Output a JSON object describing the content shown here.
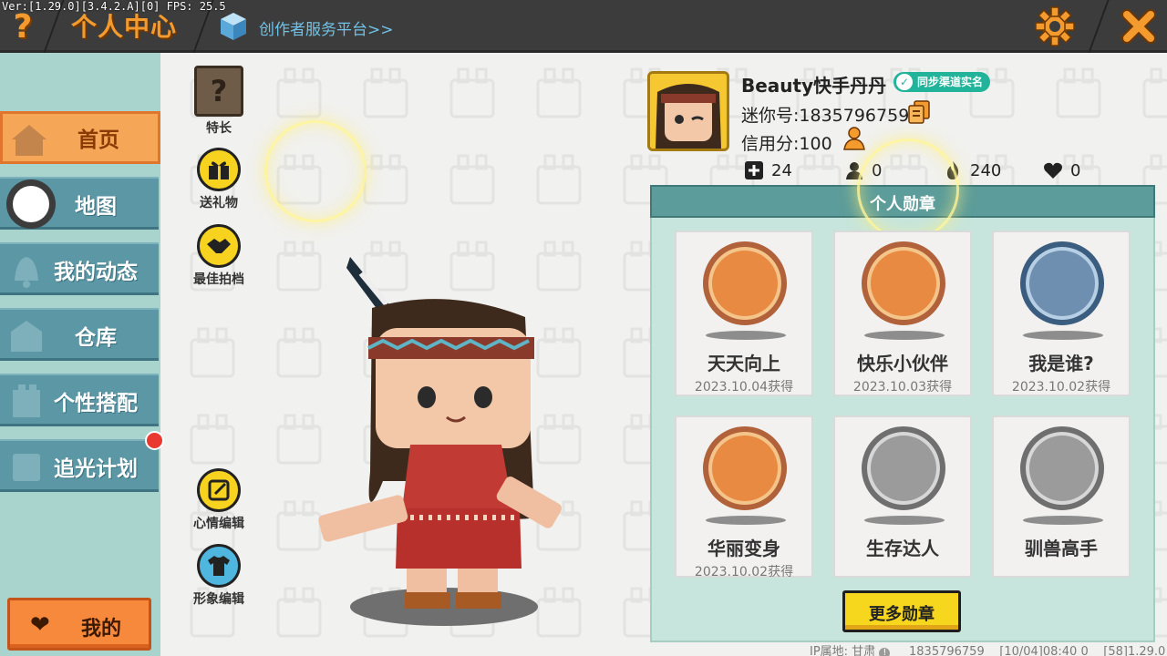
{
  "debug": "Ver:[1.29.0][3.4.2.A][0] FPS: 25.5",
  "header": {
    "help_glyph": "?",
    "title": "个人中心",
    "creator_link": "创作者服务平台>>",
    "settings_icon": "gear-icon",
    "close_icon": "close-icon"
  },
  "sidebar": {
    "items": [
      {
        "label": "首页",
        "icon": "house-icon",
        "active": true
      },
      {
        "label": "地图",
        "icon": "map-icon"
      },
      {
        "label": "我的动态",
        "icon": "bell-icon"
      },
      {
        "label": "仓库",
        "icon": "storage-icon"
      },
      {
        "label": "个性搭配",
        "icon": "outfit-icon"
      },
      {
        "label": "追光计划",
        "icon": "light-plan-icon"
      }
    ],
    "my_button": "我的"
  },
  "actions": {
    "specialty": "特长",
    "send_gift": "送礼物",
    "best_photo": "最佳拍档",
    "mood_edit": "心情编辑",
    "avatar_edit": "形象编辑"
  },
  "profile": {
    "username": "Beauty快手丹丹",
    "verify_badge": "同步渠道实名",
    "mini_id": "迷你号:1835796759",
    "credit": "信用分:100",
    "stats": {
      "friends": "24",
      "followers": "0",
      "popularity": "240",
      "likes": "0"
    }
  },
  "medals": {
    "header": "个人勋章",
    "items": [
      {
        "name": "天天向上",
        "date": "2023.10.04获得",
        "theme": "orange"
      },
      {
        "name": "快乐小伙伴",
        "date": "2023.10.03获得",
        "theme": "orange"
      },
      {
        "name": "我是谁?",
        "date": "2023.10.02获得",
        "theme": "blue"
      },
      {
        "name": "华丽变身",
        "date": "2023.10.02获得",
        "theme": "orange"
      },
      {
        "name": "生存达人",
        "date": "",
        "theme": "grey"
      },
      {
        "name": "驯兽高手",
        "date": "",
        "theme": "grey"
      }
    ],
    "more_button": "更多勋章"
  },
  "footer": {
    "ip_label": "IP属地: 甘肃",
    "id": "1835796759",
    "time": "[10/04]08:40 0",
    "version": "[58]1.29.0"
  },
  "colors": {
    "accent_orange": "#f39b2e",
    "sidebar_teal": "#5b97a5",
    "medal_header": "#5c9c9a",
    "button_yellow": "#f7d71e"
  }
}
